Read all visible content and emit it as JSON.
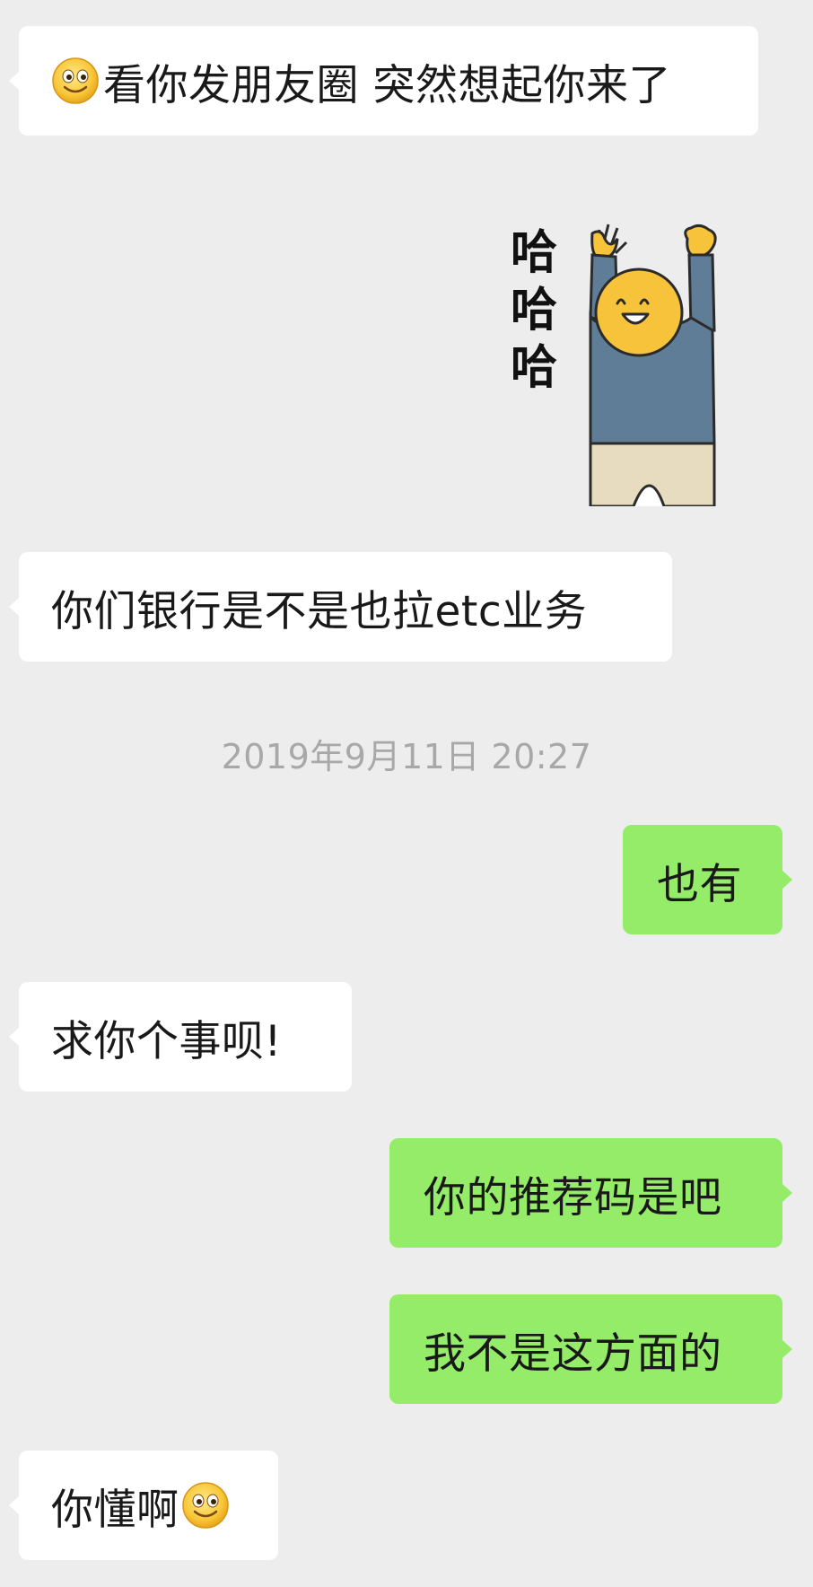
{
  "messages": [
    {
      "side": "left",
      "text": "看你发朋友圈 突然想起你来了",
      "leading_emoji": "smile-emoji-icon"
    },
    {
      "side": "right",
      "type": "sticker",
      "sticker_text": [
        "哈",
        "哈",
        "哈"
      ]
    },
    {
      "side": "left",
      "text": "你们银行是不是也拉etc业务"
    },
    {
      "type": "timestamp",
      "text": "2019年9月11日 20:27"
    },
    {
      "side": "right",
      "text": "也有"
    },
    {
      "side": "left",
      "text": "求你个事呗!"
    },
    {
      "side": "right",
      "text": "你的推荐码是吧"
    },
    {
      "side": "right",
      "text": "我不是这方面的"
    },
    {
      "side": "left",
      "text": "你懂啊",
      "trailing_emoji": "smile-emoji-icon"
    }
  ],
  "colors": {
    "background": "#ededed",
    "incoming_bubble": "#ffffff",
    "outgoing_bubble": "#95ec69",
    "timestamp_text": "#a8a8a8",
    "message_text": "#191919"
  }
}
